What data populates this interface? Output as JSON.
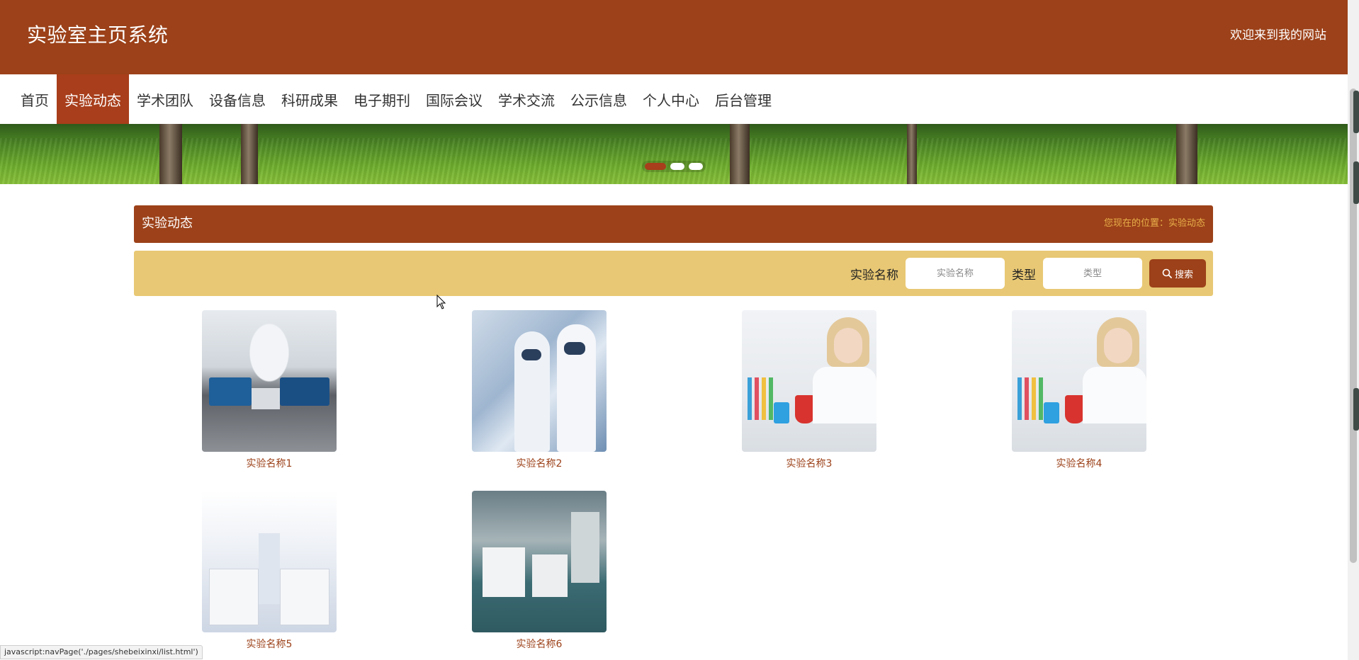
{
  "header": {
    "site_title": "实验室主页系统",
    "welcome": "欢迎来到我的网站"
  },
  "nav": {
    "items": [
      {
        "label": "首页",
        "active": false
      },
      {
        "label": "实验动态",
        "active": true
      },
      {
        "label": "学术团队",
        "active": false
      },
      {
        "label": "设备信息",
        "active": false
      },
      {
        "label": "科研成果",
        "active": false
      },
      {
        "label": "电子期刊",
        "active": false
      },
      {
        "label": "国际会议",
        "active": false
      },
      {
        "label": "学术交流",
        "active": false
      },
      {
        "label": "公示信息",
        "active": false
      },
      {
        "label": "个人中心",
        "active": false
      },
      {
        "label": "后台管理",
        "active": false
      }
    ]
  },
  "banner": {
    "slides_count": 3,
    "active_slide": 1
  },
  "section": {
    "title": "实验动态",
    "breadcrumb": "您现在的位置：实验动态"
  },
  "search": {
    "name_label": "实验名称",
    "name_placeholder": "实验名称",
    "type_label": "类型",
    "type_placeholder": "类型",
    "button_label": "搜索"
  },
  "items": [
    {
      "label": "实验名称1"
    },
    {
      "label": "实验名称2"
    },
    {
      "label": "实验名称3"
    },
    {
      "label": "实验名称4"
    },
    {
      "label": "实验名称5"
    },
    {
      "label": "实验名称6"
    }
  ],
  "statusbar": {
    "text": "javascript:navPage('./pages/shebeixinxi/list.html')"
  },
  "colors": {
    "primary": "#9c4119",
    "search_bar": "#e8c874",
    "breadcrumb": "#e8b04a"
  }
}
